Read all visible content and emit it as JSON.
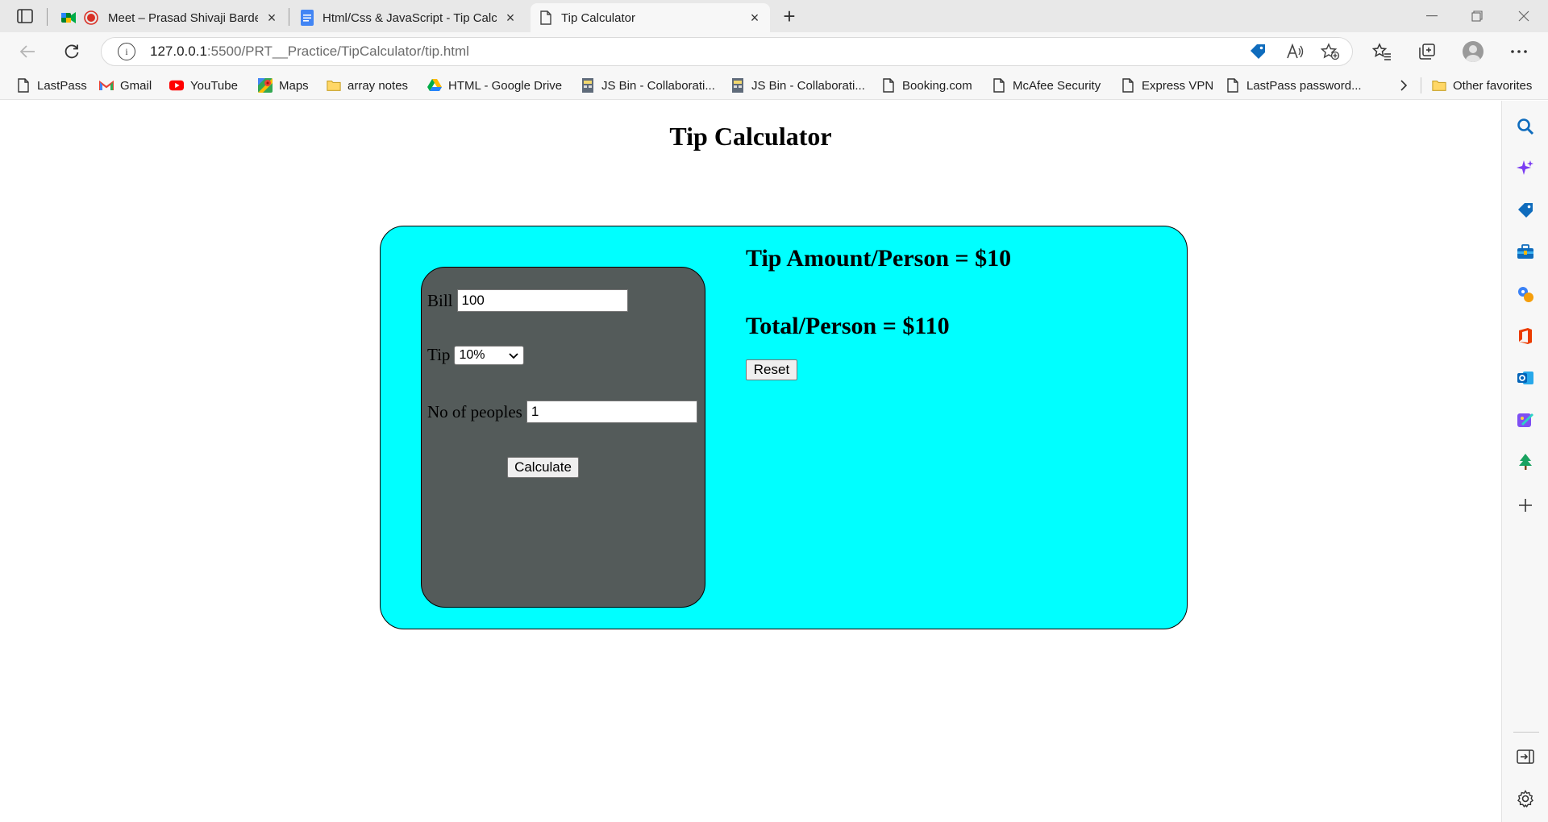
{
  "browser": {
    "tabs": [
      {
        "title": "Meet – Prasad Shivaji Barde",
        "favicon": "google-meet-icon"
      },
      {
        "title": "Html/Css & JavaScript - Tip Calcu",
        "favicon": "google-docs-icon"
      },
      {
        "title": "Tip Calculator",
        "favicon": "page-icon",
        "active": true
      }
    ],
    "url_host": "127.0.0.1",
    "url_path": ":5500/PRT__Practice/TipCalculator/tip.html",
    "bookmarks": [
      {
        "label": "LastPass",
        "icon": "page-icon"
      },
      {
        "label": "Gmail",
        "icon": "gmail-icon"
      },
      {
        "label": "YouTube",
        "icon": "youtube-icon"
      },
      {
        "label": "Maps",
        "icon": "maps-icon"
      },
      {
        "label": "array notes",
        "icon": "folder-icon"
      },
      {
        "label": "HTML - Google Drive",
        "icon": "drive-icon"
      },
      {
        "label": "JS Bin - Collaborati...",
        "icon": "jsbin-icon"
      },
      {
        "label": "JS Bin - Collaborati...",
        "icon": "jsbin-icon"
      },
      {
        "label": "Booking.com",
        "icon": "page-icon"
      },
      {
        "label": "McAfee Security",
        "icon": "page-icon"
      },
      {
        "label": "Express VPN",
        "icon": "page-icon"
      },
      {
        "label": "LastPass password...",
        "icon": "page-icon"
      }
    ],
    "other_favorites": "Other favorites"
  },
  "page": {
    "title": "Tip Calculator",
    "form": {
      "bill_label": "Bill",
      "bill_value": "100",
      "tip_label": "Tip",
      "tip_selected": "10%",
      "people_label": "No of peoples",
      "people_value": "1",
      "calculate_label": "Calculate"
    },
    "results": {
      "tip_per_person": "Tip Amount/Person = $10",
      "total_per_person": "Total/Person = $110",
      "reset_label": "Reset"
    }
  },
  "colors": {
    "calc_box": "#00ffff",
    "form_box": "#545b5a"
  }
}
